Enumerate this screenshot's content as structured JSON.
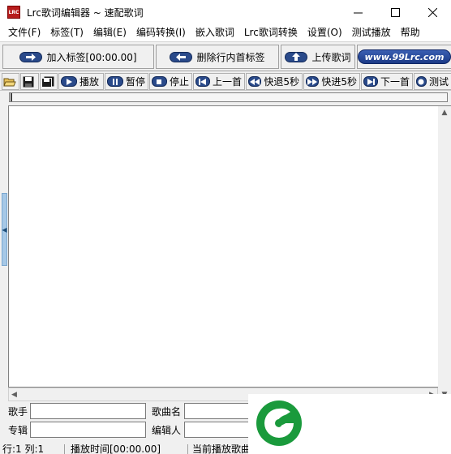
{
  "window": {
    "icon_text": "LRC",
    "title": "Lrc歌词编辑器 ~ 速配歌词"
  },
  "menu": [
    "文件(F)",
    "标签(T)",
    "编辑(E)",
    "编码转换(I)",
    "嵌入歌词",
    "Lrc歌词转换",
    "设置(O)",
    "测试播放",
    "帮助"
  ],
  "bigbar": {
    "add_tag": "加入标签[00:00.00]",
    "delete_tag": "删除行内首标签",
    "upload": "上传歌词",
    "site": "www.99Lrc.com"
  },
  "smallbar": {
    "play": "播放",
    "pause": "暂停",
    "stop": "停止",
    "prev": "上一首",
    "rewind": "快退5秒",
    "forward": "快进5秒",
    "next": "下一首",
    "test": "测试"
  },
  "fields": {
    "singer_label": "歌手",
    "song_label": "歌曲名",
    "album_label": "专辑",
    "editor_label": "编辑人",
    "singer_value": "",
    "song_value": "",
    "album_value": "",
    "editor_value": ""
  },
  "status": {
    "pos": "行:1 列:1",
    "time": "播放时间[00:00.00]",
    "current": "当前播放歌曲"
  },
  "colors": {
    "accent": "#2a4a8a",
    "logo_green": "#1a9a3c"
  }
}
